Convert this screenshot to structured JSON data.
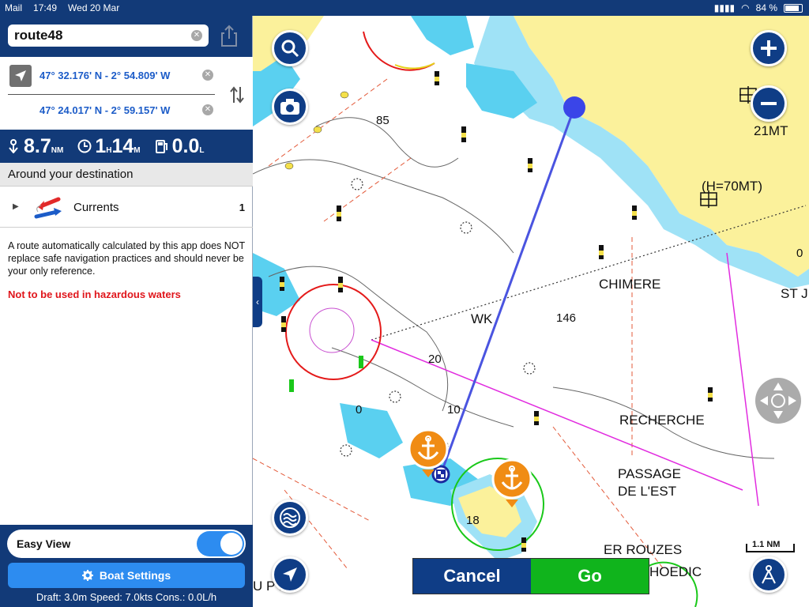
{
  "status_bar": {
    "carrier": "Mail",
    "time": "17:49",
    "date": "Wed 20 Mar",
    "battery": "84 %",
    "battery_level": 0.84
  },
  "route": {
    "name": "route48"
  },
  "coordinates": {
    "start": "47° 32.176' N - 2° 54.809' W",
    "end": "47° 24.017' N - 2° 59.157' W"
  },
  "stats": {
    "distance_value": "8.7",
    "distance_unit": "NM",
    "hours_value": "1",
    "hours_unit": "H",
    "minutes_value": "14",
    "minutes_unit": "M",
    "fuel_value": "0.0",
    "fuel_unit": "L"
  },
  "around": {
    "title": "Around your destination",
    "currents_label": "Currents",
    "currents_count": "1"
  },
  "disclaimer": "A route automatically calculated by this app does NOT replace safe navigation practices and should never be your only reference.",
  "warning": "Not to be used in hazardous waters",
  "bottom": {
    "easy_view_label": "Easy View",
    "easy_view_on": true,
    "boat_settings_label": "Boat Settings",
    "draft_line": "Draft: 3.0m Speed: 7.0kts Cons.: 0.0L/h"
  },
  "map": {
    "place_labels": {
      "chimere": "CHIMERE",
      "st": "ST J",
      "wk": "WK",
      "recherche": "RECHERCHE",
      "passage": "PASSAGE",
      "de_lest": "DE L'EST",
      "er_rouzes": "ER ROUZES",
      "hoedic": "HOEDIC",
      "u_pains": "U P   INS",
      "h70": "(H=70MT)",
      "mt21": "21MT"
    },
    "depths": {
      "d85": "85",
      "d146": "146",
      "d20": "20",
      "d10": "10",
      "d0": "0",
      "d18": "18",
      "d0r": "0"
    },
    "scale_label": "1.1  NM"
  },
  "actions": {
    "cancel_label": "Cancel",
    "go_label": "Go"
  },
  "colors": {
    "header_blue": "#123a78",
    "accent_blue": "#2d8cf0",
    "land": "#fbf19b",
    "shallow": "#5ad0f0",
    "go_green": "#10b41c",
    "warning_red": "#e0151b"
  }
}
